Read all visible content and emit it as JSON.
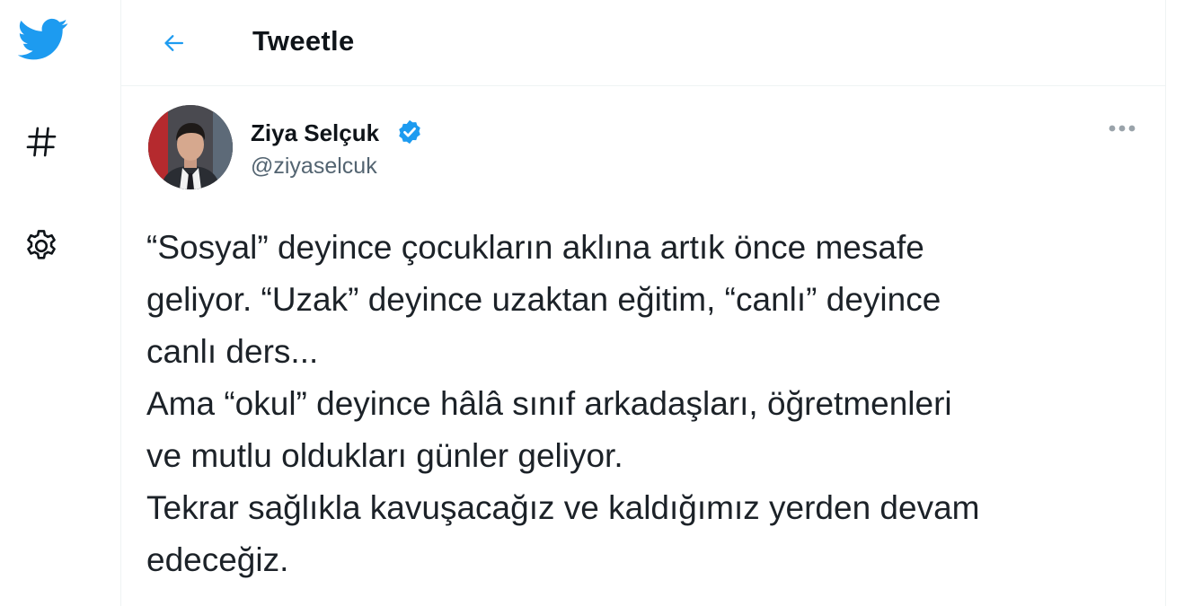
{
  "sidebar": {
    "items": [
      {
        "icon": "twitter-bird-icon"
      },
      {
        "icon": "hashtag-icon"
      },
      {
        "icon": "gear-icon"
      }
    ]
  },
  "header": {
    "back_icon": "arrow-left-icon",
    "title": "Tweetle"
  },
  "tweet": {
    "author": {
      "name": "Ziya Selçuk",
      "handle": "@ziyaselcuk",
      "verified": true
    },
    "more_icon": "more-options-icon",
    "text_lines": [
      "“Sosyal” deyince çocukların aklına artık önce mesafe",
      "geliyor. “Uzak” deyince uzaktan eğitim, “canlı” deyince",
      "canlı ders...",
      "Ama “okul” deyince hâlâ sınıf arkadaşları, öğretmenleri",
      "ve mutlu oldukları günler geliyor.",
      "Tekrar sağlıkla kavuşacağız ve kaldığımız yerden devam",
      "edeceğiz."
    ]
  },
  "colors": {
    "brand": "#1d9bf0",
    "text": "#0f1419",
    "secondary": "#536471",
    "divider": "#eff3f4"
  }
}
